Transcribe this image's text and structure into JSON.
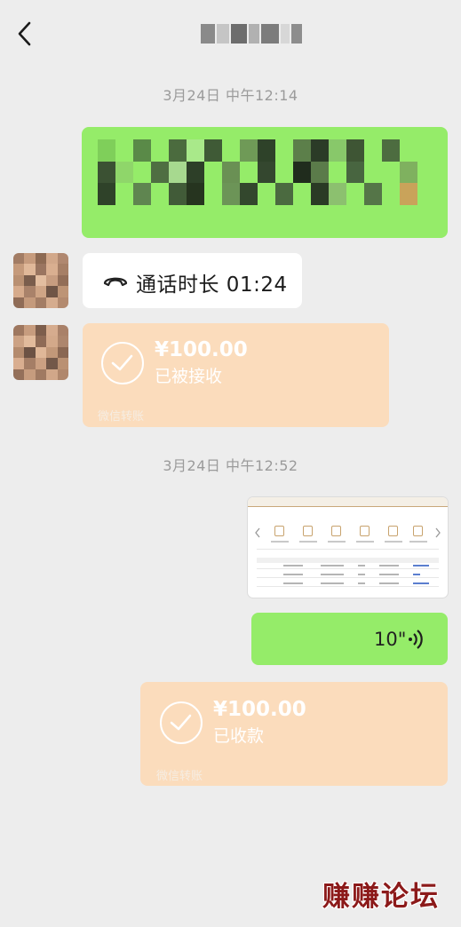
{
  "header": {
    "back_icon": "chevron-left-icon"
  },
  "timestamps": [
    "3月24日 中午12:14",
    "3月24日 中午12:52"
  ],
  "call": {
    "icon": "phone-hangup-icon",
    "text": "通话时长 01:24"
  },
  "transfer_received": {
    "amount": "¥100.00",
    "status": "已被接收",
    "footer": "微信转账",
    "icon": "check-circle-icon"
  },
  "voice": {
    "duration": "10\"",
    "icon": "voice-wave-icon"
  },
  "transfer_sent": {
    "amount": "¥100.00",
    "status": "已收款",
    "footer": "微信转账",
    "icon": "check-circle-icon"
  },
  "watermark": "赚赚论坛",
  "colors": {
    "background": "#ededed",
    "sent_bubble": "#95ec69",
    "transfer_bubble": "#fbdcbc",
    "watermark": "#8c1a1a"
  }
}
